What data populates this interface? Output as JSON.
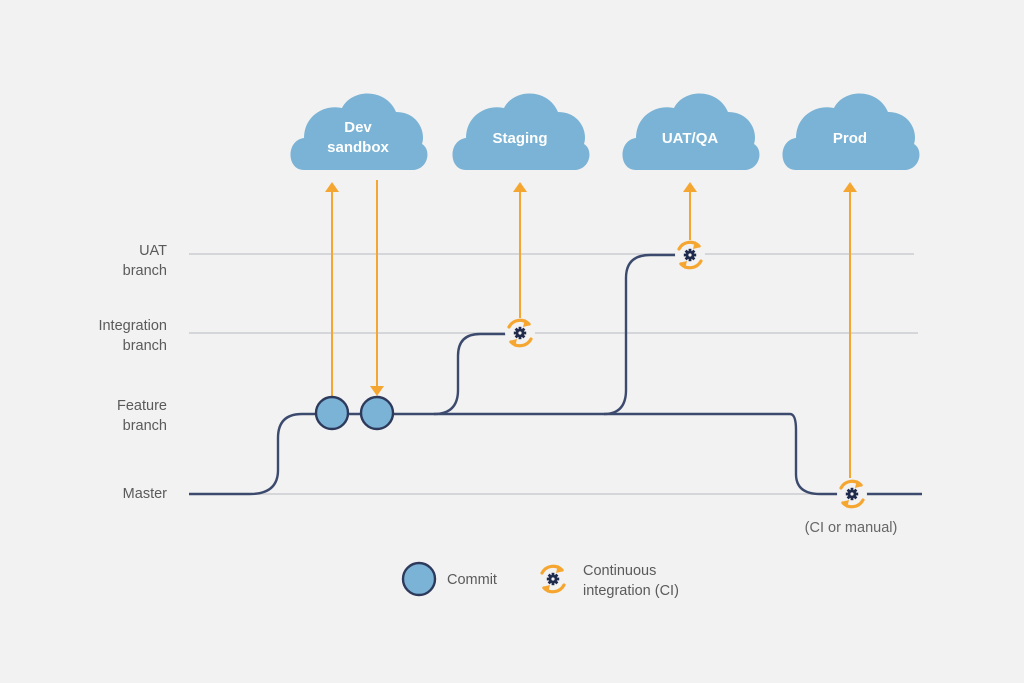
{
  "colors": {
    "background": "#f2f2f2",
    "cloud": "#7ab3d5",
    "branch_line": "#3c4a6e",
    "grid_line": "#d4d6d9",
    "arrow": "#f5a631",
    "commit_fill": "#7ab3d5",
    "commit_stroke": "#2e3a5c",
    "gear": "#1f2a4d",
    "label_text": "#5a5a5a"
  },
  "environments": [
    {
      "id": "dev",
      "lines": [
        "Dev",
        "sandbox"
      ]
    },
    {
      "id": "staging",
      "lines": [
        "Staging"
      ]
    },
    {
      "id": "uat",
      "lines": [
        "UAT/QA"
      ]
    },
    {
      "id": "prod",
      "lines": [
        "Prod"
      ]
    }
  ],
  "branches": [
    {
      "id": "uat",
      "lines": [
        "UAT",
        "branch"
      ]
    },
    {
      "id": "integration",
      "lines": [
        "Integration",
        "branch"
      ]
    },
    {
      "id": "feature",
      "lines": [
        "Feature",
        "branch"
      ]
    },
    {
      "id": "master",
      "lines": [
        "Master"
      ]
    }
  ],
  "events": [
    {
      "type": "commit",
      "branch": "feature",
      "arrow": "to-dev"
    },
    {
      "type": "commit",
      "branch": "feature",
      "arrow": "from-dev"
    },
    {
      "type": "ci",
      "branch": "integration",
      "arrow": "to-staging"
    },
    {
      "type": "ci",
      "branch": "uat",
      "arrow": "to-uat-qa"
    },
    {
      "type": "ci",
      "branch": "master",
      "arrow": "to-prod"
    }
  ],
  "master_note": "(CI or manual)",
  "legend": {
    "commit_label": "Commit",
    "ci_label_lines": [
      "Continuous",
      "integration (CI)"
    ]
  }
}
